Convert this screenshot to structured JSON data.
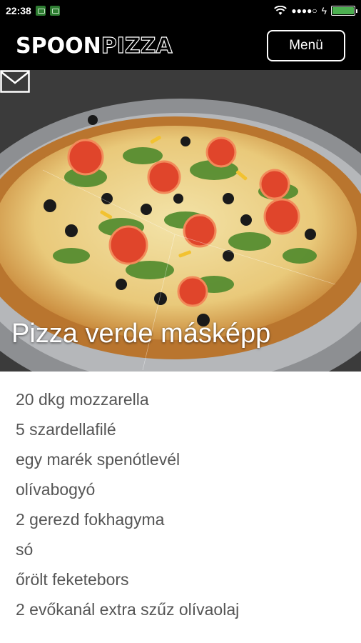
{
  "status_bar": {
    "time": "22:38",
    "signal": "●●●●○",
    "charge_symbol": "ϟ",
    "battery_level": 1.0
  },
  "header": {
    "logo_part1": "SPOON",
    "logo_part2": "PIZZA",
    "menu_label": "Menü"
  },
  "hero": {
    "title": "Pizza verde másképp"
  },
  "ingredients": [
    "20 dkg mozzarella",
    "5 szardellafilé",
    "egy marék spenótlevél",
    "olívabogyó",
    "2 gerezd fokhagyma",
    "só",
    "őrölt feketebors",
    "2 evőkanál extra szűz olívaolaj"
  ]
}
